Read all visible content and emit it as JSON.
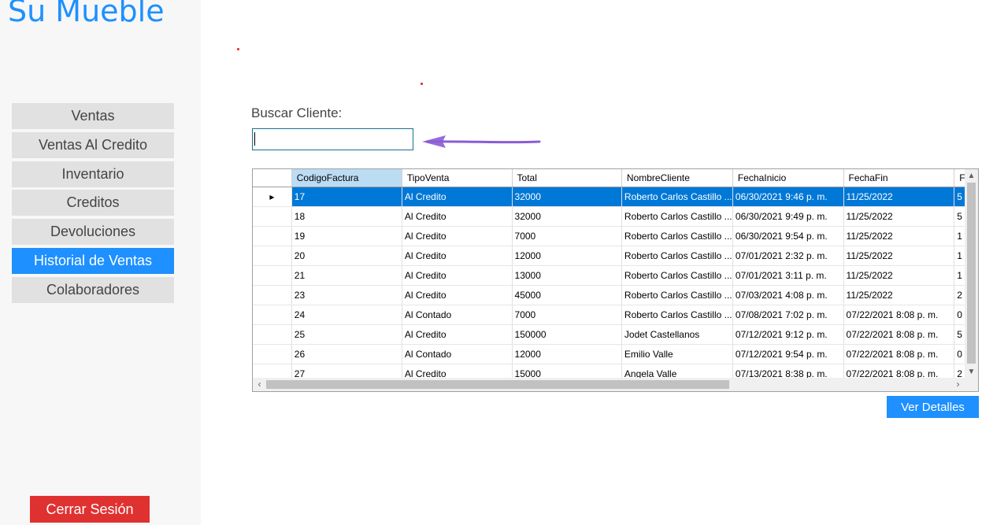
{
  "app": {
    "title": "Su Mueble"
  },
  "sidebar": {
    "items": [
      {
        "label": "Ventas"
      },
      {
        "label": "Ventas Al Credito"
      },
      {
        "label": "Inventario"
      },
      {
        "label": "Creditos"
      },
      {
        "label": "Devoluciones"
      },
      {
        "label": "Historial de Ventas"
      },
      {
        "label": "Colaboradores"
      }
    ],
    "active_index": 5,
    "logout_label": "Cerrar Sesión"
  },
  "search": {
    "label": "Buscar Cliente:",
    "value": "",
    "placeholder": ""
  },
  "grid": {
    "columns": [
      "CodigoFactura",
      "TipoVenta",
      "Total",
      "NombreCliente",
      "FechaInicio",
      "FechaFin",
      "F"
    ],
    "selected_row_index": 0,
    "rows": [
      [
        "17",
        "Al Credito",
        "32000",
        "Roberto Carlos Castillo ...",
        "06/30/2021 9:46 p. m.",
        "11/25/2022",
        "5"
      ],
      [
        "18",
        "Al Credito",
        "32000",
        "Roberto Carlos Castillo ...",
        "06/30/2021 9:49 p. m.",
        "11/25/2022",
        "5"
      ],
      [
        "19",
        "Al Credito",
        "7000",
        "Roberto Carlos Castillo ...",
        "06/30/2021 9:54 p. m.",
        "11/25/2022",
        "1"
      ],
      [
        "20",
        "Al Credito",
        "12000",
        "Roberto Carlos Castillo ...",
        "07/01/2021 2:32 p. m.",
        "11/25/2022",
        "1"
      ],
      [
        "21",
        "Al Credito",
        "13000",
        "Roberto Carlos Castillo ...",
        "07/01/2021 3:11 p. m.",
        "11/25/2022",
        "1"
      ],
      [
        "23",
        "Al Credito",
        "45000",
        "Roberto Carlos Castillo ...",
        "07/03/2021 4:08 p. m.",
        "11/25/2022",
        "2"
      ],
      [
        "24",
        "Al Contado",
        "7000",
        "Roberto Carlos Castillo ...",
        "07/08/2021 7:02 p. m.",
        "07/22/2021 8:08 p. m.",
        "0"
      ],
      [
        "25",
        "Al Credito",
        "150000",
        "Jodet Castellanos",
        "07/12/2021 9:12 p. m.",
        "07/22/2021 8:08 p. m.",
        "5"
      ],
      [
        "26",
        "Al Contado",
        "12000",
        "Emilio Valle",
        "07/12/2021 9:54 p. m.",
        "07/22/2021 8:08 p. m.",
        "0"
      ],
      [
        "27",
        "Al Credito",
        "15000",
        "Angela Valle",
        "07/13/2021 8:38 p. m.",
        "07/22/2021 8:08 p. m.",
        "2"
      ]
    ]
  },
  "details_button": {
    "label": "Ver Detalles"
  },
  "colors": {
    "accent": "#1e90ff",
    "danger": "#e03131",
    "selection": "#0078d7",
    "annotation_arrow": "#8a5cd6"
  }
}
